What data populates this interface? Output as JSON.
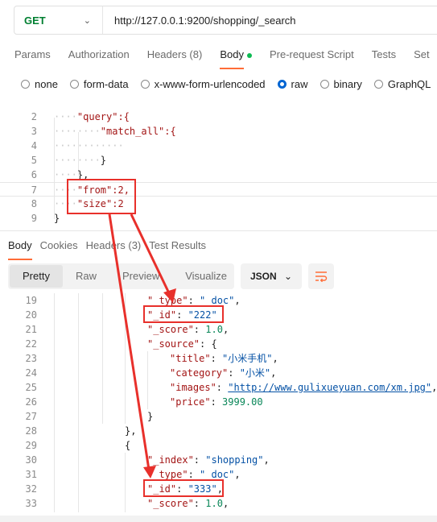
{
  "request": {
    "method": "GET",
    "url": "http://127.0.0.1:9200/shopping/_search"
  },
  "tabs": [
    "Params",
    "Authorization",
    "Headers (8)",
    "Body",
    "Pre-request Script",
    "Tests",
    "Set"
  ],
  "active_tab": "Body",
  "body_types": [
    "none",
    "form-data",
    "x-www-form-urlencoded",
    "raw",
    "binary",
    "GraphQL"
  ],
  "selected_body_type": "raw",
  "editor_lines": [
    {
      "n": "2",
      "text": "\"query\":{"
    },
    {
      "n": "3",
      "text": "\"match_all\":{"
    },
    {
      "n": "4",
      "text": ""
    },
    {
      "n": "5",
      "text": "}"
    },
    {
      "n": "6",
      "text": "},"
    },
    {
      "n": "7",
      "text": "\"from\":2,"
    },
    {
      "n": "8",
      "text": "\"size\":2"
    },
    {
      "n": "9",
      "text": "}"
    }
  ],
  "response_tabs": [
    "Body",
    "Cookies",
    "Headers (3)",
    "Test Results"
  ],
  "active_response_tab": "Body",
  "view_modes": [
    "Pretty",
    "Raw",
    "Preview",
    "Visualize"
  ],
  "active_view": "Pretty",
  "format": "JSON",
  "response_lines": [
    {
      "n": "19",
      "key": "\"_type\"",
      "val": "\"_doc\"",
      "sep": ": ",
      "end": ","
    },
    {
      "n": "20",
      "key": "\"_id\"",
      "val": "\"222\"",
      "sep": ": ",
      "end": ""
    },
    {
      "n": "21",
      "key": "\"_score\"",
      "val": "1.0",
      "sep": ": ",
      "end": ","
    },
    {
      "n": "22",
      "key": "\"_source\"",
      "val": "{",
      "sep": ": ",
      "end": ""
    },
    {
      "n": "23",
      "key": "\"title\"",
      "val": "\"小米手机\"",
      "sep": ": ",
      "end": ","
    },
    {
      "n": "24",
      "key": "\"category\"",
      "val": "\"小米\"",
      "sep": ": ",
      "end": ","
    },
    {
      "n": "25",
      "key": "\"images\"",
      "val": "\"http://www.gulixueyuan.com/xm.jpg\"",
      "sep": ": ",
      "end": ","
    },
    {
      "n": "26",
      "key": "\"price\"",
      "val": "3999.00",
      "sep": ": ",
      "end": ""
    },
    {
      "n": "27",
      "key": "",
      "val": "}",
      "sep": "",
      "end": ""
    },
    {
      "n": "28",
      "key": "",
      "val": "},",
      "sep": "",
      "end": ""
    },
    {
      "n": "29",
      "key": "",
      "val": "{",
      "sep": "",
      "end": ""
    },
    {
      "n": "30",
      "key": "\"_index\"",
      "val": "\"shopping\"",
      "sep": ": ",
      "end": ","
    },
    {
      "n": "31",
      "key": "\"_type\"",
      "val": "\"_doc\"",
      "sep": ": ",
      "end": ","
    },
    {
      "n": "32",
      "key": "\"_id\"",
      "val": "\"333\"",
      "sep": ": ",
      "end": ","
    },
    {
      "n": "33",
      "key": "\"_score\"",
      "val": "1.0",
      "sep": ": ",
      "end": ","
    }
  ],
  "colors": {
    "accent": "#ff6c37",
    "method": "#007f31",
    "annotation": "#e8302b",
    "radio_selected": "#0265d2"
  }
}
